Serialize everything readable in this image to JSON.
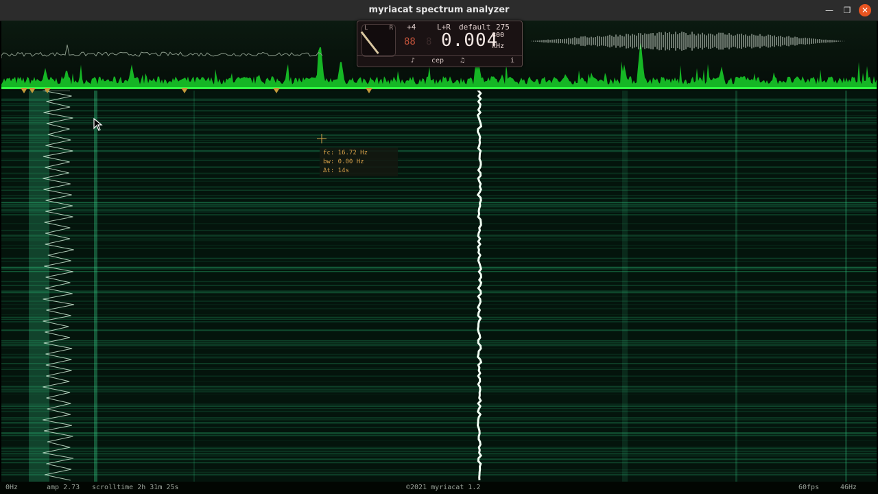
{
  "window": {
    "title": "myriacat spectrum analyzer"
  },
  "panel": {
    "meter_left": "L",
    "meter_right": "R",
    "channel_offset": "+4",
    "channel": "L+R",
    "preset": "default",
    "preset_value": "275",
    "seg_display": "88",
    "seg_active": "8",
    "frequency": "0.004",
    "freq_upper": "800",
    "unit": "kHz",
    "buttons": [
      "♪",
      "cep",
      "♫",
      "i"
    ]
  },
  "tooltip": {
    "fc": "fc: 16.72 Hz",
    "bw": "bw: 0.00 Hz",
    "dt": "Δt: 14s"
  },
  "status": {
    "min_freq": "0Hz",
    "amp": "amp 2.73",
    "scrolltime": "scrolltime 2h 31m 25s",
    "copyright": "©2021 myriacat 1.2",
    "fps": "60fps",
    "max_freq": "46Hz"
  },
  "colors": {
    "accent_green": "#19d42a",
    "spectrogram_green": "#0d6a40",
    "close_button": "#e95420",
    "marker_orange": "#c49a3a"
  },
  "icons": {
    "minimize": "minimize-icon",
    "maximize": "maximize-icon",
    "close": "close-icon",
    "cursor": "mouse-cursor-icon"
  }
}
